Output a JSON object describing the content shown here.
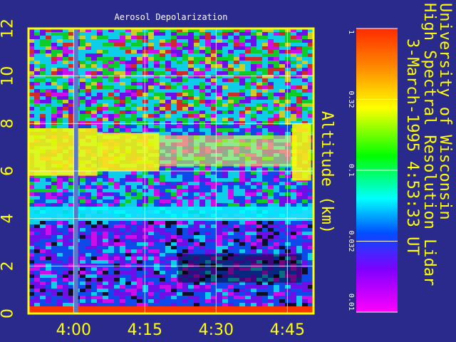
{
  "chart_data": {
    "type": "heatmap",
    "title": "Aerosol Depolarization",
    "ylabel": "Altitude (km)",
    "yticks": [
      "0",
      "2",
      "4",
      "6",
      "8",
      "10",
      "12"
    ],
    "ylim": [
      0,
      12
    ],
    "xticks": [
      "4:00",
      "4:15",
      "4:30",
      "4:45"
    ],
    "xtick_minutes": [
      0,
      15,
      30,
      45
    ],
    "xlim_minutes": [
      -9.5,
      50.5
    ],
    "grid": true,
    "colorbar": {
      "ticks": [
        "1",
        "0.32",
        "0.1",
        "0.032",
        "0.01"
      ],
      "values": [
        1,
        0.32,
        0.1,
        0.032,
        0.01
      ],
      "scale": "log",
      "colors": [
        "#ff2a00",
        "#ff8c00",
        "#ffff00",
        "#00ff00",
        "#00ffff",
        "#0050ff",
        "#8000ff",
        "#ff00ff"
      ]
    },
    "layers": [
      {
        "name": "",
        "alt_low": 5.8,
        "alt_high": 7.8,
        "start_min": -9.5,
        "end_min": 5,
        "level": "high"
      },
      {
        "name": "",
        "alt_low": 6.0,
        "alt_high": 7.6,
        "start_min": 5,
        "end_min": 18,
        "level": "high"
      },
      {
        "name": "",
        "alt_low": 6.2,
        "alt_high": 7.5,
        "start_min": 18,
        "end_min": 47,
        "level": "patchy"
      },
      {
        "name": "",
        "alt_low": 5.6,
        "alt_high": 8.0,
        "start_min": 46,
        "end_min": 50,
        "level": "high"
      },
      {
        "name": "",
        "alt_low": 3.9,
        "alt_high": 4.5,
        "start_min": -9.5,
        "end_min": 50.5,
        "level": "mid"
      },
      {
        "name": "",
        "alt_low": 1.3,
        "alt_high": 2.5,
        "start_min": 22,
        "end_min": 48,
        "level": "low"
      }
    ],
    "data_gap_minutes": 0.5
  },
  "side_text": {
    "line1": "University of Wisconsin",
    "line2": "High Spectral Resolution Lidar",
    "line3": "3-March-1995   4:53:33 UT"
  }
}
